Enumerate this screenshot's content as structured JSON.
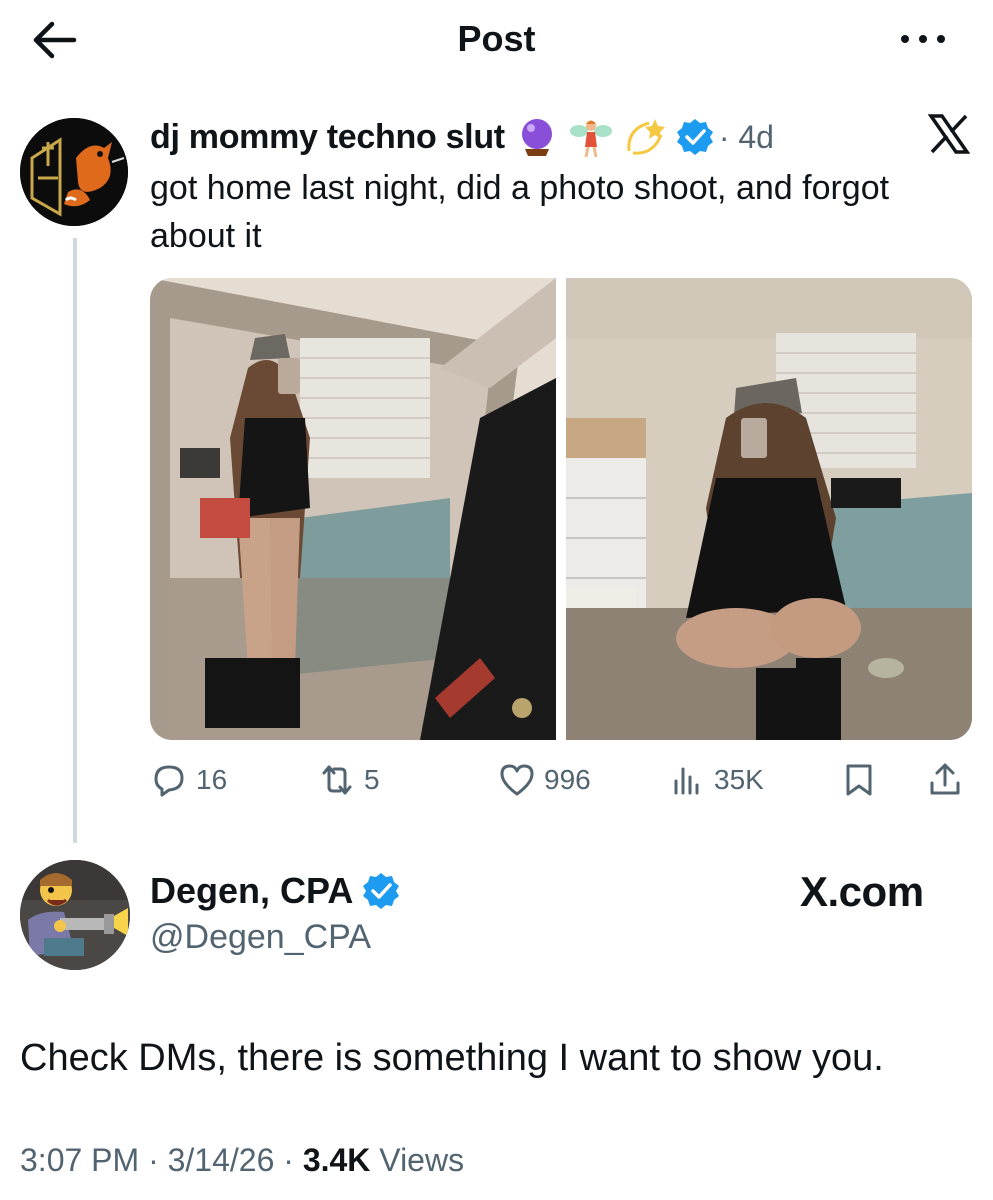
{
  "header": {
    "title": "Post",
    "back_icon": "arrow-left-icon",
    "more_icon": "more-horizontal-icon"
  },
  "quoted_post": {
    "author_name": "dj mommy techno slut",
    "emojis": [
      "crystal-ball",
      "fairy",
      "dizzy"
    ],
    "verified": true,
    "timestamp": "4d",
    "source_icon": "x-logo-icon",
    "text": "got home last night, did a photo shoot, and forgot about it",
    "media": [
      {
        "type": "photo",
        "description": "mirror selfie standing"
      },
      {
        "type": "photo",
        "description": "mirror selfie squatting"
      }
    ],
    "stats": {
      "replies": "16",
      "reposts": "5",
      "likes": "996",
      "views": "35K"
    }
  },
  "post": {
    "author_name": "Degen, CPA",
    "handle": "@Degen_CPA",
    "verified": true,
    "brand": "X.com",
    "text": "Check DMs, there is something I want to show you.",
    "time": "3:07 PM",
    "date": "3/14/26",
    "views_count": "3.4K",
    "views_label": "Views",
    "separator": " · "
  },
  "colors": {
    "verified_blue": "#1d9bf0",
    "secondary_text": "#536471",
    "primary_text": "#0f1419"
  }
}
